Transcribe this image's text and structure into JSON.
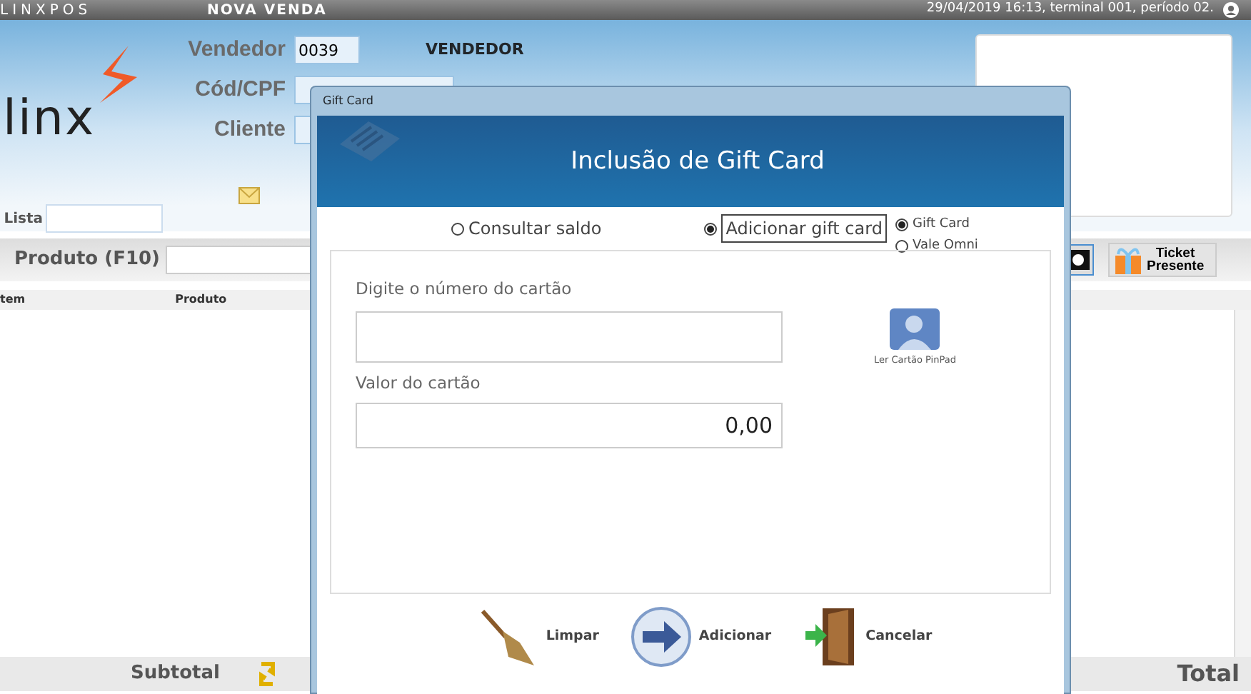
{
  "top_bar": {
    "app_name": "LINXPOS",
    "screen_title": "NOVA VENDA",
    "session_info": "29/04/2019 16:13, terminal 001, período 02."
  },
  "logo": {
    "text": "linx"
  },
  "header_fields": [
    {
      "label": "Vendedor",
      "value": "0039",
      "caption": "VENDEDOR"
    },
    {
      "label": "Cód/CPF"
    },
    {
      "label": "Cliente"
    }
  ],
  "list_field": {
    "label": "Lista"
  },
  "product_field": {
    "label": "Produto (F10)"
  },
  "ticket_button": {
    "label": "Ticket Presente"
  },
  "table": {
    "columns": [
      "tem",
      "Produto"
    ]
  },
  "footer": {
    "subtotal_label": "Subtotal",
    "total_label": "Total"
  },
  "dialog": {
    "title": "Gift Card",
    "heading": "Inclusão de Gift Card",
    "modes": [
      {
        "label": "Consultar saldo",
        "selected": false
      },
      {
        "label": "Adicionar gift card",
        "selected": true
      }
    ],
    "card_types": [
      {
        "label": "Gift Card",
        "selected": true
      },
      {
        "label": "Vale Omni",
        "selected": false
      }
    ],
    "card_number": {
      "label": "Digite o número do cartão"
    },
    "card_value": {
      "label": "Valor do cartão",
      "value": "0,00"
    },
    "pinpad": {
      "label": "Ler Cartão PinPad"
    },
    "buttons": [
      {
        "kind": "clear",
        "label": "Limpar"
      },
      {
        "kind": "add",
        "label": "Adicionar"
      },
      {
        "kind": "cancel",
        "label": "Cancelar"
      }
    ]
  }
}
